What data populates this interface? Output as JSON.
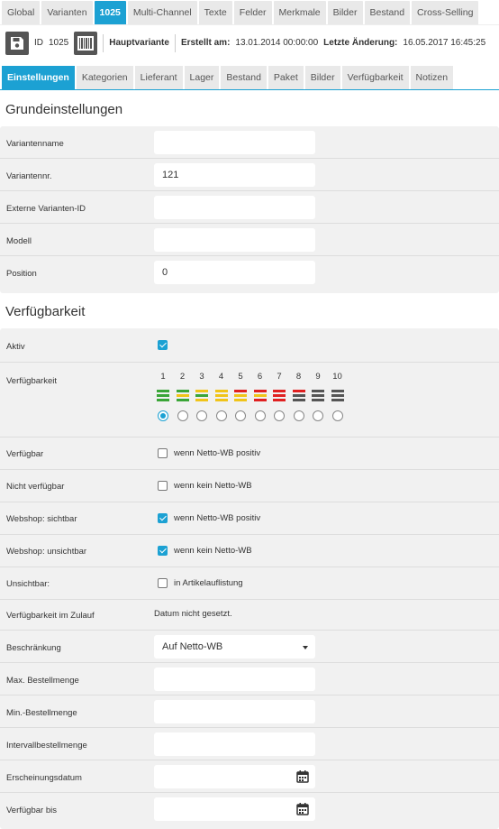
{
  "top_tabs": [
    "Global",
    "Varianten",
    "1025",
    "Multi-Channel",
    "Texte",
    "Felder",
    "Merkmale",
    "Bilder",
    "Bestand",
    "Cross-Selling"
  ],
  "top_tab_active": 2,
  "header": {
    "id_label": "ID",
    "id_value": "1025",
    "variant_type": "Hauptvariante",
    "created_label": "Erstellt am:",
    "created_value": "13.01.2014 00:00:00",
    "changed_label": "Letzte Änderung:",
    "changed_value": "16.05.2017 16:45:25"
  },
  "sub_tabs": [
    "Einstellungen",
    "Kategorien",
    "Lieferant",
    "Lager",
    "Bestand",
    "Paket",
    "Bilder",
    "Verfügbarkeit",
    "Notizen"
  ],
  "sub_tab_active": 0,
  "grund": {
    "title": "Grundeinstellungen",
    "fields": [
      {
        "label": "Variantenname",
        "value": ""
      },
      {
        "label": "Variantennr.",
        "value": "121"
      },
      {
        "label": "Externe Varianten-ID",
        "value": ""
      },
      {
        "label": "Modell",
        "value": ""
      },
      {
        "label": "Position",
        "value": "0"
      }
    ]
  },
  "verf": {
    "title": "Verfügbarkeit",
    "aktiv_label": "Aktiv",
    "aktiv_checked": true,
    "availability_label": "Verfügbarkeit",
    "availability_levels": [
      {
        "num": "1",
        "color": "#3aa537",
        "bars": 3
      },
      {
        "num": "2",
        "color": "#3aa537",
        "bars": 3,
        "mixed": [
          "#3aa537",
          "#f0c419",
          "#3aa537"
        ]
      },
      {
        "num": "3",
        "color": "#f0c419",
        "bars": 3,
        "mixed": [
          "#f0c419",
          "#3aa537",
          "#f0c419"
        ]
      },
      {
        "num": "4",
        "color": "#f0c419",
        "bars": 3
      },
      {
        "num": "5",
        "color": "#f0c419",
        "bars": 3,
        "mixed": [
          "#e02020",
          "#f0c419",
          "#f0c419"
        ]
      },
      {
        "num": "6",
        "color": "#e02020",
        "bars": 3,
        "mixed": [
          "#e02020",
          "#f0c419",
          "#e02020"
        ]
      },
      {
        "num": "7",
        "color": "#e02020",
        "bars": 3
      },
      {
        "num": "8",
        "color": "#555555",
        "bars": 3,
        "mixed": [
          "#e02020",
          "#555555",
          "#555555"
        ]
      },
      {
        "num": "9",
        "color": "#555555",
        "bars": 3
      },
      {
        "num": "10",
        "color": "#555555",
        "bars": 3
      }
    ],
    "availability_selected": 0,
    "checkbox_rows": [
      {
        "label": "Verfügbar",
        "text": "wenn Netto-WB positiv",
        "checked": false
      },
      {
        "label": "Nicht verfügbar",
        "text": "wenn kein Netto-WB",
        "checked": false
      },
      {
        "label": "Webshop: sichtbar",
        "text": "wenn Netto-WB positiv",
        "checked": true
      },
      {
        "label": "Webshop: unsichtbar",
        "text": "wenn kein Netto-WB",
        "checked": true
      },
      {
        "label": "Unsichtbar:",
        "text": "in Artikelauflistung",
        "checked": false
      }
    ],
    "zulauf_label": "Verfügbarkeit im Zulauf",
    "zulauf_value": "Datum nicht gesetzt.",
    "beschr_label": "Beschränkung",
    "beschr_value": "Auf Netto-WB",
    "max_label": "Max. Bestellmenge",
    "max_value": "",
    "min_label": "Min.-Bestellmenge",
    "min_value": "",
    "intervall_label": "Intervallbestellmenge",
    "intervall_value": "",
    "erschein_label": "Erscheinungsdatum",
    "erschein_value": "",
    "bis_label": "Verfügbar bis",
    "bis_value": ""
  },
  "colors": {
    "accent": "#1ca1d3",
    "panel": "#f1f1f1"
  }
}
